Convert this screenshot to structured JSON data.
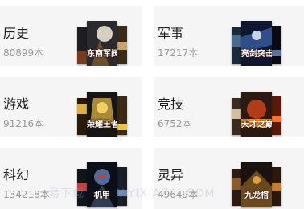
{
  "categories": [
    {
      "name": "历史",
      "count": "80899本",
      "cover_title": "东南军阀",
      "colors": [
        "#2b2b2f",
        "#d7cfc2",
        "#6d4e2d"
      ]
    },
    {
      "name": "军事",
      "count": "17217本",
      "cover_title": "亮剑突击队",
      "colors": [
        "#0e1730",
        "#2f4f8a",
        "#c9d3e6"
      ]
    },
    {
      "name": "游戏",
      "count": "91216本",
      "cover_title": "荣耀王者",
      "colors": [
        "#151515",
        "#a88a3a",
        "#f0d060"
      ]
    },
    {
      "name": "竞技",
      "count": "6752本",
      "cover_title": "天才之巅",
      "colors": [
        "#2a1a14",
        "#b23b18",
        "#f5a030"
      ]
    },
    {
      "name": "科幻",
      "count": "134218本",
      "cover_title": "机甲",
      "colors": [
        "#0b0f18",
        "#4e6b9a",
        "#c74040"
      ]
    },
    {
      "name": "灵异",
      "count": "49649本",
      "cover_title": "九龙棺",
      "colors": [
        "#1a120c",
        "#6b4a22",
        "#e0a040"
      ]
    }
  ],
  "watermark": "易下载 WWW.YIXIAZAI.COM"
}
